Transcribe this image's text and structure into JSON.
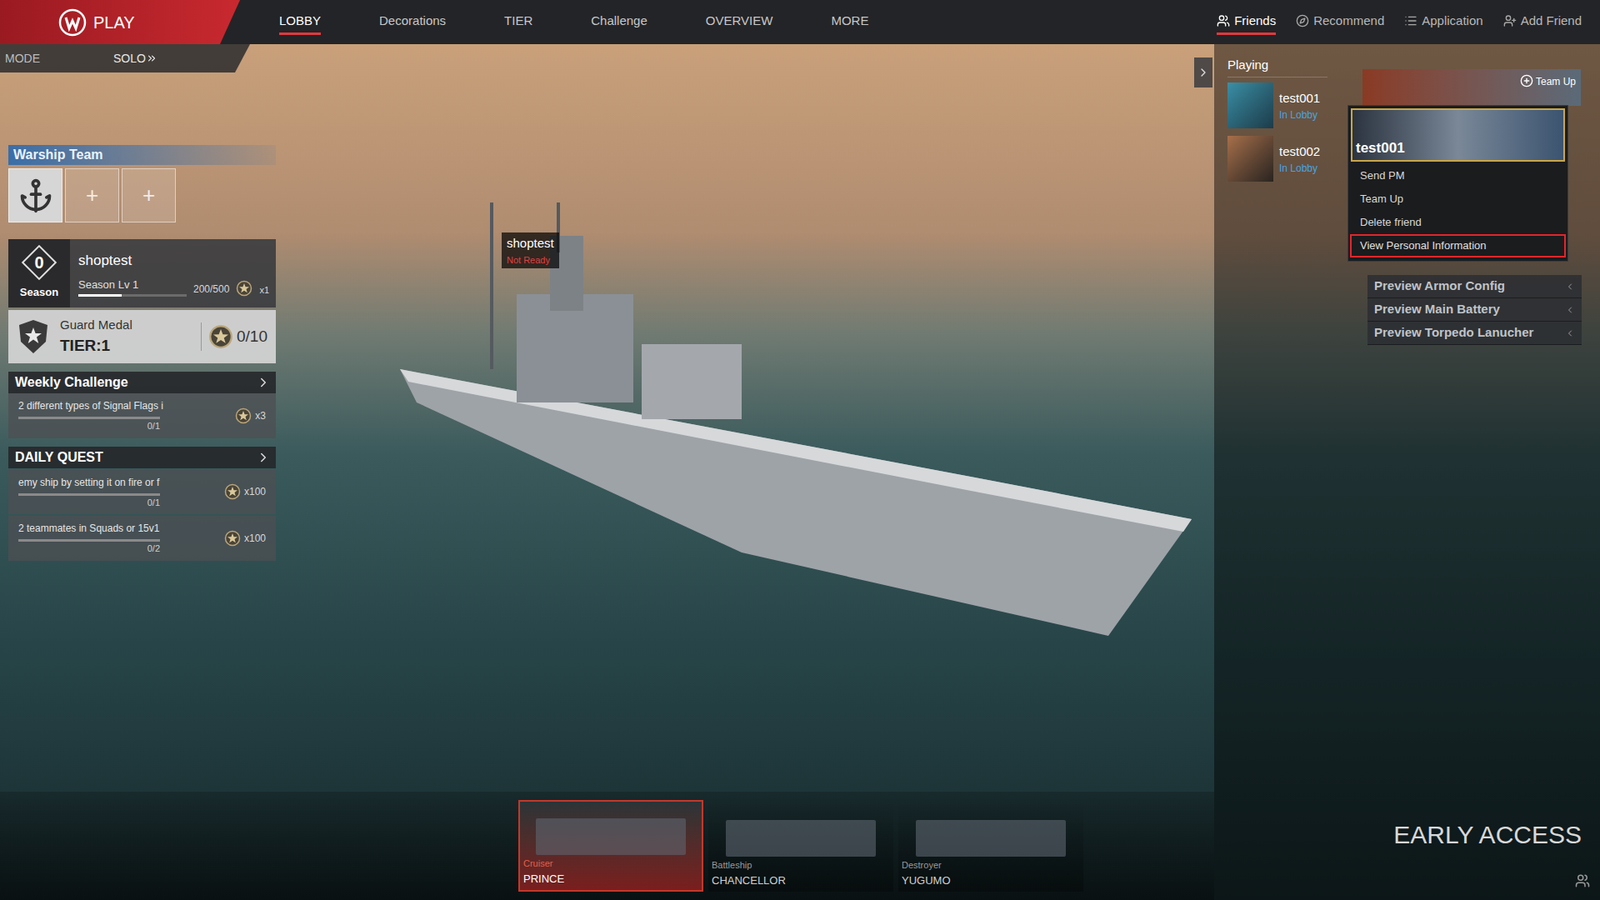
{
  "topbar": {
    "logo": "PLAY",
    "nav": [
      {
        "label": "LOBBY",
        "selected": true
      },
      {
        "label": "Decorations",
        "selected": false
      },
      {
        "label": "TIER",
        "selected": false
      },
      {
        "label": "Challenge",
        "selected": false
      },
      {
        "label": "OVERVIEW",
        "selected": false
      },
      {
        "label": "MORE",
        "selected": false
      }
    ],
    "social": [
      {
        "label": "Friends",
        "selected": true
      },
      {
        "label": "Recommend",
        "selected": false
      },
      {
        "label": "Application",
        "selected": false
      },
      {
        "label": "Add Friend",
        "selected": false
      }
    ]
  },
  "mode_bar": {
    "label": "MODE",
    "value": "SOLO"
  },
  "warship_team": {
    "title": "Warship Team",
    "slots": [
      {
        "kind": "captain"
      },
      {
        "kind": "empty",
        "label": "+"
      },
      {
        "kind": "empty",
        "label": "+"
      }
    ]
  },
  "season": {
    "number": "0",
    "label": "Season",
    "player": "shoptest",
    "level_label": "Season Lv",
    "season_level": "1",
    "level": 0.4,
    "reading": "200/500",
    "reward": "x1"
  },
  "medal": {
    "name": "Guard Medal",
    "tier": "TIER:1",
    "count": "0/10"
  },
  "weekly_challenge": {
    "title": "Weekly Challenge",
    "items": [
      {
        "text": "2 different types of Signal Flags i",
        "progress": "0/1",
        "level": 0,
        "reward": "x3"
      }
    ]
  },
  "daily_quest": {
    "title": "DAILY QUEST",
    "items": [
      {
        "text": "emy ship by setting it on fire or f",
        "progress": "0/1",
        "level": 0,
        "reward": "x100"
      },
      {
        "text": "2 teammates in Squads or 15v1",
        "progress": "0/2",
        "level": 0,
        "reward": "x100"
      }
    ]
  },
  "ship_tag": {
    "name": "shoptest",
    "status": "Not Ready"
  },
  "ships": [
    {
      "class": "Cruiser",
      "name": "PRINCE",
      "selected": true
    },
    {
      "class": "Battleship",
      "name": "CHANCELLOR",
      "selected": false
    },
    {
      "class": "Destroyer",
      "name": "YUGUMO",
      "selected": false
    }
  ],
  "friends_panel": {
    "section": "Playing",
    "friends": [
      {
        "name": "test001",
        "status": "In Lobby"
      },
      {
        "name": "test002",
        "status": "In Lobby"
      }
    ],
    "banner_button": "Team Up"
  },
  "context_menu": {
    "title": "test001",
    "items": [
      {
        "label": "Send PM",
        "highlighted": false
      },
      {
        "label": "Team Up",
        "highlighted": false
      },
      {
        "label": "Delete friend",
        "highlighted": false
      },
      {
        "label": "View Personal Information",
        "highlighted": true
      }
    ]
  },
  "preview_menu": [
    {
      "label": "Preview Armor Config"
    },
    {
      "label": "Preview Main Battery"
    },
    {
      "label": "Preview Torpedo Lanucher"
    }
  ],
  "watermark": "EARLY ACCESS"
}
